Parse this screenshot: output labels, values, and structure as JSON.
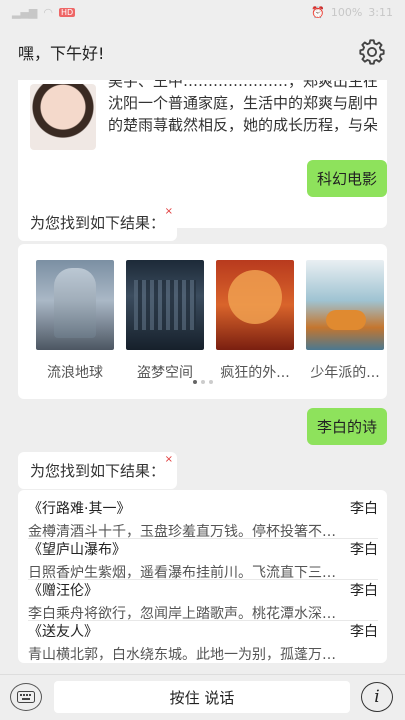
{
  "status": {
    "battery": "100%",
    "time": "3:11",
    "badge": "HD"
  },
  "header": {
    "greeting": "嘿，下午好!"
  },
  "intro": {
    "text": "吴宇、王中…………………，郑爽出生在沈阳一个普通家庭，生活中的郑爽与剧中的楚雨荨截然相反，她的成长历程，与朵草的生活其实毫不"
  },
  "messages": {
    "scifi": "科幻电影",
    "result_label_1": "为您找到如下结果：",
    "libai": "李白的诗",
    "result_label_2": "为您找到如下结果："
  },
  "movies": [
    {
      "title": "流浪地球"
    },
    {
      "title": "盗梦空间"
    },
    {
      "title": "疯狂的外..."
    },
    {
      "title": "少年派的..."
    }
  ],
  "poems": [
    {
      "title": "《行路难·其一》",
      "author": "李白",
      "line": "金樽清酒斗十千，玉盘珍羞直万钱。停杯投箸不…"
    },
    {
      "title": "《望庐山瀑布》",
      "author": "李白",
      "line": "日照香炉生紫烟，遥看瀑布挂前川。飞流直下三…"
    },
    {
      "title": "《赠汪伦》",
      "author": "李白",
      "line": "李白乘舟将欲行，忽闻岸上踏歌声。桃花潭水深…"
    },
    {
      "title": "《送友人》",
      "author": "李白",
      "line": "青山横北郭，白水绕东城。此地一为别，孤蓬万…"
    }
  ],
  "bottom": {
    "talk_label": "按住 说话",
    "info_glyph": "i"
  }
}
